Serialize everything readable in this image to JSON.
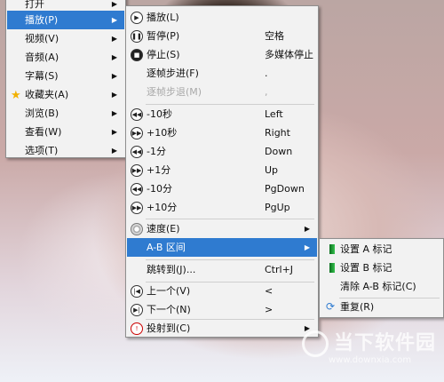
{
  "main_menu": {
    "items": [
      {
        "label": "打开",
        "submenu": true
      },
      {
        "label": "播放(P)",
        "submenu": true,
        "highlight": true
      },
      {
        "label": "视频(V)",
        "submenu": true
      },
      {
        "label": "音频(A)",
        "submenu": true
      },
      {
        "label": "字幕(S)",
        "submenu": true
      },
      {
        "label": "收藏夹(A)",
        "submenu": true,
        "icon": "star-icon"
      },
      {
        "label": "浏览(B)",
        "submenu": true
      },
      {
        "label": "查看(W)",
        "submenu": true
      },
      {
        "label": "选项(T)",
        "submenu": true
      }
    ]
  },
  "play_menu": {
    "items": [
      {
        "label": "播放(L)",
        "shortcut": "",
        "icon": "play-icon"
      },
      {
        "label": "暂停(P)",
        "shortcut": "空格",
        "icon": "pause-icon"
      },
      {
        "label": "停止(S)",
        "shortcut": "多媒体停止",
        "icon": "stop-icon"
      },
      {
        "label": "逐帧步进(F)",
        "shortcut": "."
      },
      {
        "label": "逐帧步退(M)",
        "shortcut": ",",
        "disabled": true
      },
      {
        "label": "-10秒",
        "shortcut": "Left",
        "icon": "rewind-icon"
      },
      {
        "label": "+10秒",
        "shortcut": "Right",
        "icon": "forward-icon"
      },
      {
        "label": "-1分",
        "shortcut": "Down",
        "icon": "rewind-icon"
      },
      {
        "label": "+1分",
        "shortcut": "Up",
        "icon": "forward-icon"
      },
      {
        "label": "-10分",
        "shortcut": "PgDown",
        "icon": "rewind-icon"
      },
      {
        "label": "+10分",
        "shortcut": "PgUp",
        "icon": "forward-icon"
      },
      {
        "label": "速度(E)",
        "shortcut": "",
        "icon": "speed-icon",
        "submenu": true
      },
      {
        "label": "A-B 区间",
        "shortcut": "",
        "submenu": true,
        "highlight": true
      },
      {
        "label": "跳转到(J)...",
        "shortcut": "Ctrl+J"
      },
      {
        "label": "上一个(V)",
        "shortcut": "<",
        "icon": "previous-icon"
      },
      {
        "label": "下一个(N)",
        "shortcut": ">",
        "icon": "next-icon"
      },
      {
        "label": "投射到(C)",
        "shortcut": "",
        "icon": "cast-icon",
        "submenu": true
      }
    ]
  },
  "ab_menu": {
    "items": [
      {
        "label": "设置 A 标记",
        "icon": "flag-a-icon"
      },
      {
        "label": "设置 B 标记",
        "icon": "flag-b-icon"
      },
      {
        "label": "清除 A-B 标记(C)"
      },
      {
        "label": "重复(R)",
        "icon": "repeat-icon"
      }
    ]
  },
  "watermark": {
    "text": "当下软件园",
    "url": "www.downxia.com"
  },
  "colors": {
    "highlight": "#2f7bd0",
    "menu_bg": "#f2f2f2",
    "disabled": "#a9a9a9"
  }
}
